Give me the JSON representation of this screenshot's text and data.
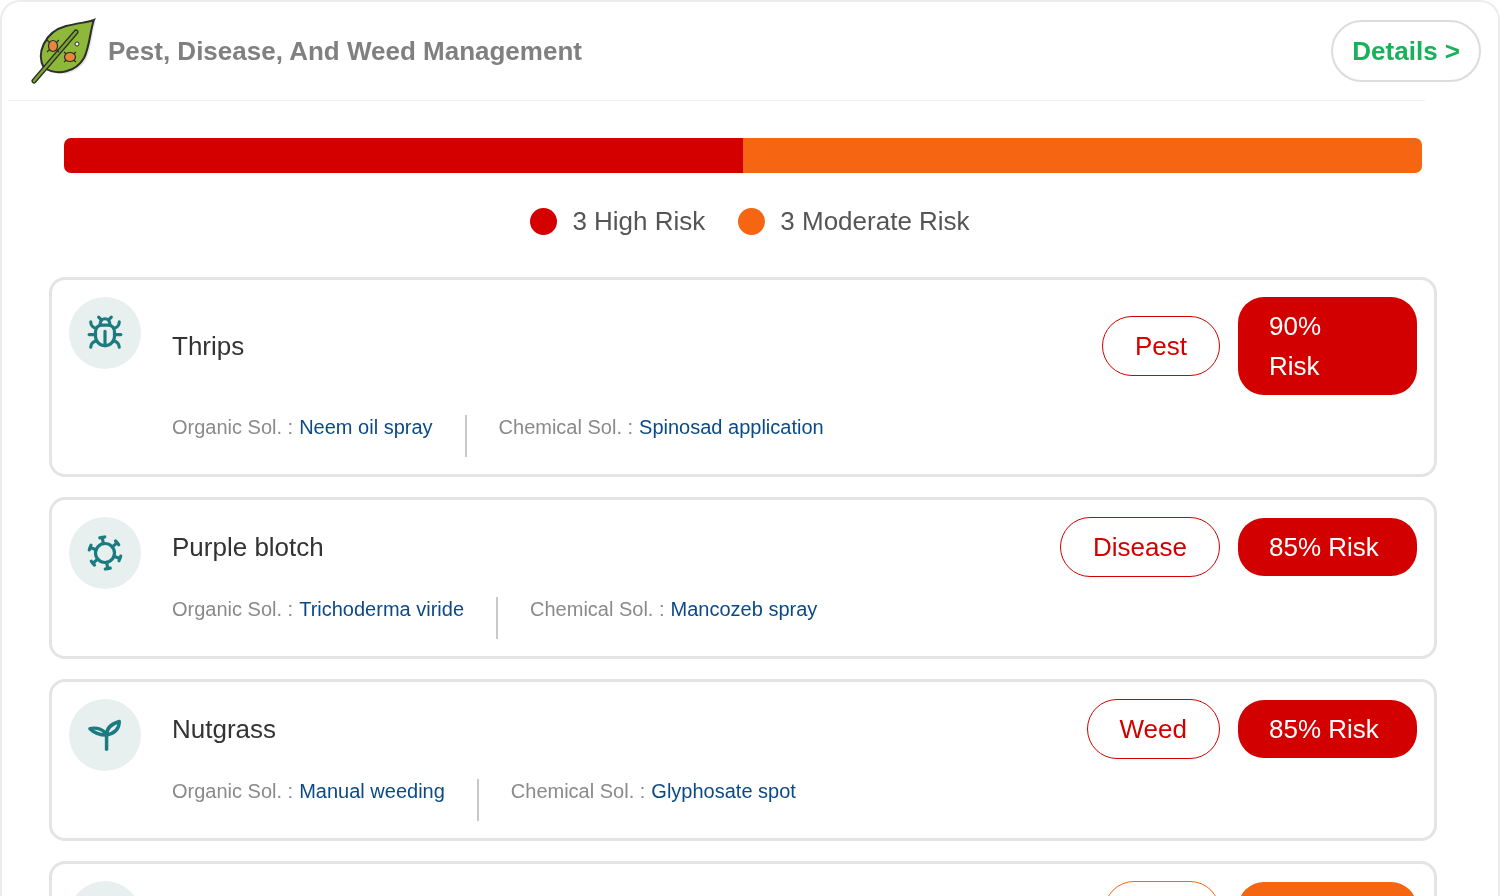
{
  "header": {
    "title": "Pest, Disease, And Weed Management",
    "details_button": "Details >"
  },
  "risk_bar": {
    "segments": [
      {
        "level": 0.5,
        "color": "#d40000"
      },
      {
        "level": 0.5,
        "color": "#f66511"
      }
    ]
  },
  "legend": [
    {
      "label": "3 High Risk",
      "color": "#d40000"
    },
    {
      "label": "3 Moderate Risk",
      "color": "#f66511"
    }
  ],
  "issues": [
    {
      "kind": "pest",
      "name": "Thrips",
      "category": "Pest",
      "risk": "90% Risk",
      "risk_stacked": true,
      "color": "#d30000",
      "solutions": [
        {
          "label": "Organic Sol. :",
          "value": "Neem oil spray"
        },
        {
          "label": "Chemical Sol. :",
          "value": "Spinosad application"
        }
      ]
    },
    {
      "kind": "disease",
      "name": "Purple blotch",
      "category": "Disease",
      "risk": "85% Risk",
      "risk_stacked": false,
      "color": "#d30000",
      "solutions": [
        {
          "label": "Organic Sol. :",
          "value": "Trichoderma viride"
        },
        {
          "label": "Chemical Sol. :",
          "value": "Mancozeb spray"
        }
      ]
    },
    {
      "kind": "weed",
      "name": "Nutgrass",
      "category": "Weed",
      "risk": "85% Risk",
      "risk_stacked": false,
      "color": "#d30000",
      "solutions": [
        {
          "label": "Organic Sol. :",
          "value": "Manual weeding"
        },
        {
          "label": "Chemical Sol. :",
          "value": "Glyphosate spot"
        }
      ]
    },
    {
      "color": "#f66511"
    }
  ]
}
